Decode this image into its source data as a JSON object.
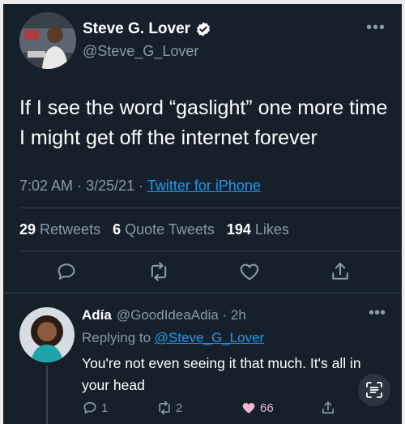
{
  "tweet": {
    "author_name": "Steve G. Lover",
    "handle": "@Steve_G_Lover",
    "text": "If I see the word “gaslight” one more time I might get off the internet forever",
    "time": "7:02 AM",
    "date": "3/25/21",
    "source": "Twitter for iPhone",
    "retweets": "29",
    "retweets_label": "Retweets",
    "quotes": "6",
    "quotes_label": "Quote Tweets",
    "likes": "194",
    "likes_label": "Likes",
    "more": "•••"
  },
  "reply": {
    "author_name": "Adía",
    "handle": "@GoodIdeaAdia",
    "age": "2h",
    "replying_prefix": "Replying to",
    "replying_to": "@Steve_G_Lover",
    "text": "You're not even seeing it that much. It's all in your head",
    "reply_count": "1",
    "retweet_count": "2",
    "like_count": "66",
    "more": "•••"
  },
  "colors": {
    "background": "#15202b",
    "accent": "#1d9bf0",
    "secondary_text": "#8b98a5",
    "divider": "#38444d",
    "like": "#f4b3d2"
  },
  "icons": [
    "verified-badge-icon",
    "reply-icon",
    "retweet-icon",
    "like-icon",
    "share-icon",
    "more-icon",
    "text-scan-icon"
  ]
}
